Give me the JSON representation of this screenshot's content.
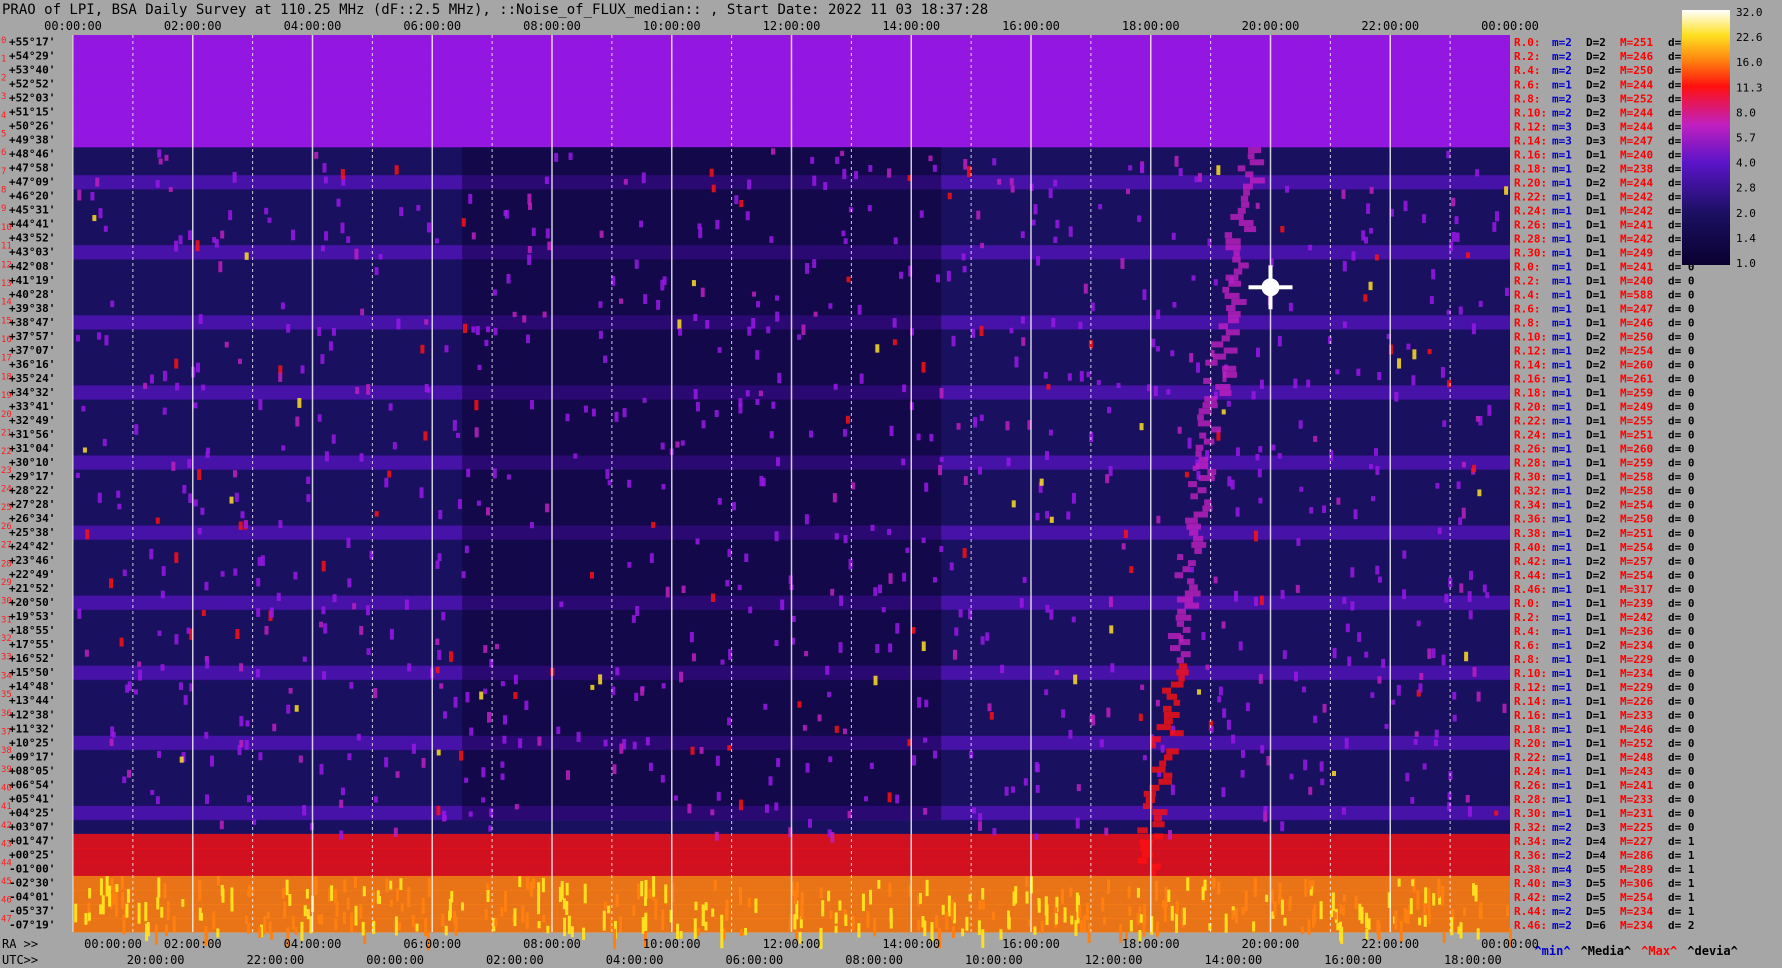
{
  "title": "PRAO of LPI, BSA Daily Survey at 110.25 MHz (dF::2.5 MHz), ::Noise_of_FLUX_median:: , Start Date: 2022 11 03 18:37:28",
  "chart_data": {
    "type": "heatmap",
    "top_ticks": [
      "00:00:00",
      "02:00:00",
      "04:00:00",
      "06:00:00",
      "08:00:00",
      "10:00:00",
      "12:00:00",
      "14:00:00",
      "16:00:00",
      "18:00:00",
      "20:00:00",
      "22:00:00",
      "00:00:00"
    ],
    "ra_ticks": [
      "00:00:00",
      "02:00:00",
      "04:00:00",
      "06:00:00",
      "08:00:00",
      "10:00:00",
      "12:00:00",
      "14:00:00",
      "16:00:00",
      "18:00:00",
      "20:00:00",
      "22:00:00",
      "00:00:00"
    ],
    "utc_ticks": [
      "20:00:00",
      "22:00:00",
      "00:00:00",
      "02:00:00",
      "04:00:00",
      "06:00:00",
      "08:00:00",
      "10:00:00",
      "12:00:00",
      "14:00:00",
      "16:00:00",
      "18:00:00"
    ],
    "ra_label": "RA >>",
    "utc_label": "UTC>>",
    "declinations": [
      "+55°17'",
      "+54°29'",
      "+53°40'",
      "+52°52'",
      "+52°03'",
      "+51°15'",
      "+50°26'",
      "+49°38'",
      "+48°46'",
      "+47°58'",
      "+47°09'",
      "+46°20'",
      "+45°31'",
      "+44°41'",
      "+43°52'",
      "+43°03'",
      "+42°08'",
      "+41°19'",
      "+40°28'",
      "+39°38'",
      "+38°47'",
      "+37°57'",
      "+37°07'",
      "+36°16'",
      "+35°24'",
      "+34°32'",
      "+33°41'",
      "+32°49'",
      "+31°56'",
      "+31°04'",
      "+30°10'",
      "+29°17'",
      "+28°22'",
      "+27°28'",
      "+26°34'",
      "+25°38'",
      "+24°42'",
      "+23°46'",
      "+22°49'",
      "+21°52'",
      "+20°50'",
      "+19°53'",
      "+18°55'",
      "+17°55'",
      "+16°52'",
      "+15°50'",
      "+14°48'",
      "+13°44'",
      "+12°38'",
      "+11°32'",
      "+10°25'",
      "+09°17'",
      "+08°05'",
      "+06°54'",
      "+05°41'",
      "+04°25'",
      "+03°07'",
      "+01°47'",
      "+00°25'",
      "-01°00'",
      "-02°30'",
      "-04°01'",
      "-05°37'",
      "-07°19'"
    ],
    "row_indices": [
      "0",
      "1",
      "2",
      "3",
      "4",
      "5",
      "6",
      "7",
      "8",
      "9",
      "10",
      "11",
      "12",
      "13",
      "14",
      "15",
      "16",
      "17",
      "18",
      "19",
      "20",
      "21",
      "22",
      "23",
      "24",
      "25",
      "26",
      "27",
      "28",
      "29",
      "30",
      "31",
      "32",
      "33",
      "34",
      "35",
      "36",
      "37",
      "38",
      "39",
      "40",
      "41",
      "42",
      "43",
      "44",
      "45",
      "46",
      "47"
    ],
    "row_stats": [
      [
        "R.0:",
        "m=2",
        "D=2",
        "M=251",
        "d= 0"
      ],
      [
        "R.2:",
        "m=2",
        "D=2",
        "M=246",
        "d= 0"
      ],
      [
        "R.4:",
        "m=2",
        "D=2",
        "M=250",
        "d= 0"
      ],
      [
        "R.6:",
        "m=1",
        "D=2",
        "M=244",
        "d= 0"
      ],
      [
        "R.8:",
        "m=2",
        "D=3",
        "M=252",
        "d= 0"
      ],
      [
        "R.10:",
        "m=2",
        "D=2",
        "M=244",
        "d="
      ],
      [
        "R.12:",
        "m=3",
        "D=3",
        "M=244",
        "d="
      ],
      [
        "R.14:",
        "m=3",
        "D=3",
        "M=247",
        "d="
      ],
      [
        "R.16:",
        "m=1",
        "D=1",
        "M=240",
        "d="
      ],
      [
        "R.18:",
        "m=1",
        "D=2",
        "M=238",
        "d="
      ],
      [
        "R.20:",
        "m=1",
        "D=2",
        "M=244",
        "d="
      ],
      [
        "R.22:",
        "m=1",
        "D=1",
        "M=242",
        "d="
      ],
      [
        "R.24:",
        "m=1",
        "D=1",
        "M=242",
        "d="
      ],
      [
        "R.26:",
        "m=1",
        "D=1",
        "M=241",
        "d="
      ],
      [
        "R.28:",
        "m=1",
        "D=1",
        "M=242",
        "d="
      ],
      [
        "R.30:",
        "m=1",
        "D=1",
        "M=249",
        "d="
      ],
      [
        "R.0:",
        "m=1",
        "D=1",
        "M=241",
        "d= 0"
      ],
      [
        "R.2:",
        "m=1",
        "D=1",
        "M=240",
        "d= 0"
      ],
      [
        "R.4:",
        "m=1",
        "D=1",
        "M=588",
        "d= 0"
      ],
      [
        "R.6:",
        "m=1",
        "D=1",
        "M=247",
        "d= 0"
      ],
      [
        "R.8:",
        "m=1",
        "D=1",
        "M=246",
        "d= 0"
      ],
      [
        "R.10:",
        "m=1",
        "D=2",
        "M=250",
        "d= 0"
      ],
      [
        "R.12:",
        "m=1",
        "D=2",
        "M=254",
        "d= 0"
      ],
      [
        "R.14:",
        "m=1",
        "D=2",
        "M=260",
        "d= 0"
      ],
      [
        "R.16:",
        "m=1",
        "D=1",
        "M=261",
        "d= 0"
      ],
      [
        "R.18:",
        "m=1",
        "D=1",
        "M=259",
        "d= 0"
      ],
      [
        "R.20:",
        "m=1",
        "D=1",
        "M=249",
        "d= 0"
      ],
      [
        "R.22:",
        "m=1",
        "D=1",
        "M=255",
        "d= 0"
      ],
      [
        "R.24:",
        "m=1",
        "D=1",
        "M=251",
        "d= 0"
      ],
      [
        "R.26:",
        "m=1",
        "D=1",
        "M=260",
        "d= 0"
      ],
      [
        "R.28:",
        "m=1",
        "D=1",
        "M=259",
        "d= 0"
      ],
      [
        "R.30:",
        "m=1",
        "D=1",
        "M=258",
        "d= 0"
      ],
      [
        "R.32:",
        "m=1",
        "D=2",
        "M=258",
        "d= 0"
      ],
      [
        "R.34:",
        "m=1",
        "D=2",
        "M=254",
        "d= 0"
      ],
      [
        "R.36:",
        "m=1",
        "D=2",
        "M=250",
        "d= 0"
      ],
      [
        "R.38:",
        "m=1",
        "D=2",
        "M=251",
        "d= 0"
      ],
      [
        "R.40:",
        "m=1",
        "D=1",
        "M=254",
        "d= 0"
      ],
      [
        "R.42:",
        "m=1",
        "D=2",
        "M=257",
        "d= 0"
      ],
      [
        "R.44:",
        "m=1",
        "D=2",
        "M=254",
        "d= 0"
      ],
      [
        "R.46:",
        "m=1",
        "D=1",
        "M=317",
        "d= 0"
      ],
      [
        "R.0:",
        "m=1",
        "D=1",
        "M=239",
        "d= 0"
      ],
      [
        "R.2:",
        "m=1",
        "D=1",
        "M=242",
        "d= 0"
      ],
      [
        "R.4:",
        "m=1",
        "D=1",
        "M=236",
        "d= 0"
      ],
      [
        "R.6:",
        "m=1",
        "D=2",
        "M=234",
        "d= 0"
      ],
      [
        "R.8:",
        "m=1",
        "D=1",
        "M=229",
        "d= 0"
      ],
      [
        "R.10:",
        "m=1",
        "D=1",
        "M=234",
        "d= 0"
      ],
      [
        "R.12:",
        "m=1",
        "D=1",
        "M=229",
        "d= 0"
      ],
      [
        "R.14:",
        "m=1",
        "D=1",
        "M=226",
        "d= 0"
      ],
      [
        "R.16:",
        "m=1",
        "D=1",
        "M=233",
        "d= 0"
      ],
      [
        "R.18:",
        "m=1",
        "D=1",
        "M=246",
        "d= 0"
      ],
      [
        "R.20:",
        "m=1",
        "D=1",
        "M=252",
        "d= 0"
      ],
      [
        "R.22:",
        "m=1",
        "D=1",
        "M=248",
        "d= 0"
      ],
      [
        "R.24:",
        "m=1",
        "D=1",
        "M=243",
        "d= 0"
      ],
      [
        "R.26:",
        "m=1",
        "D=1",
        "M=241",
        "d= 0"
      ],
      [
        "R.28:",
        "m=1",
        "D=1",
        "M=233",
        "d= 0"
      ],
      [
        "R.30:",
        "m=1",
        "D=1",
        "M=231",
        "d= 0"
      ],
      [
        "R.32:",
        "m=2",
        "D=3",
        "M=225",
        "d= 0"
      ],
      [
        "R.34:",
        "m=2",
        "D=4",
        "M=227",
        "d= 1"
      ],
      [
        "R.36:",
        "m=2",
        "D=4",
        "M=286",
        "d= 1"
      ],
      [
        "R.38:",
        "m=4",
        "D=5",
        "M=289",
        "d= 1"
      ],
      [
        "R.40:",
        "m=3",
        "D=5",
        "M=306",
        "d= 1"
      ],
      [
        "R.42:",
        "m=2",
        "D=5",
        "M=254",
        "d= 1"
      ],
      [
        "R.44:",
        "m=2",
        "D=5",
        "M=234",
        "d= 1"
      ],
      [
        "R.46:",
        "m=2",
        "D=6",
        "M=234",
        "d= 2"
      ]
    ],
    "colorbar_ticks": [
      "32.0",
      "22.6",
      "16.0",
      "11.3",
      "8.0",
      "5.7",
      "4.0",
      "2.8",
      "2.0",
      "1.4",
      "1.0"
    ],
    "colorbar_scale": "log",
    "colors": {
      "deep": "#0a0030",
      "indigo": "#1a1060",
      "violet": "#5a14c8",
      "purple": "#9a18e8",
      "magenta": "#c020c0",
      "red": "#ff1010",
      "orange": "#ff8010",
      "yellow": "#ffe020",
      "white": "#ffffff"
    },
    "legend": [
      "^min^",
      "^Media^",
      "^Max^",
      "^devia^"
    ]
  }
}
